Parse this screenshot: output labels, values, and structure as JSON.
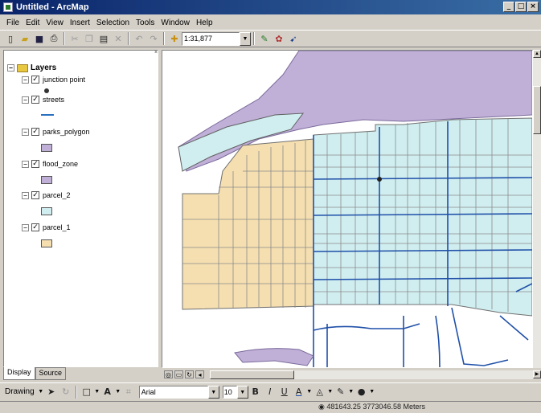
{
  "window": {
    "title": "Untitled - ArcMap",
    "buttons": [
      "_",
      "□",
      "×"
    ]
  },
  "menu": [
    "File",
    "Edit",
    "View",
    "Insert",
    "Selection",
    "Tools",
    "Window",
    "Help"
  ],
  "toolbar": {
    "scale": "1:31,877"
  },
  "toc": {
    "root_label": "Layers",
    "layers": [
      {
        "name": "junction point",
        "symbol": "point",
        "color": "#333333"
      },
      {
        "name": "streets",
        "symbol": "line",
        "color": "#2a6fc0"
      },
      {
        "name": "parks_polygon",
        "symbol": "polygon",
        "color": "#c0b0d8"
      },
      {
        "name": "flood_zone",
        "symbol": "polygon",
        "color": "#c0b0d8"
      },
      {
        "name": "parcel_2",
        "symbol": "polygon",
        "color": "#d0eef0"
      },
      {
        "name": "parcel_1",
        "symbol": "polygon",
        "color": "#f5dfb0"
      }
    ],
    "tabs": [
      "Display",
      "Source"
    ]
  },
  "drawing": {
    "label": "Drawing",
    "font": "Arial",
    "size": "10"
  },
  "status": {
    "coordinates": "481643.25  3773046.58 Meters"
  },
  "colors": {
    "flood": "#c0b0d8",
    "parcel1": "#f5dfb0",
    "parcel2": "#d0eef0",
    "street": "#1f4fa8",
    "parcel_line": "#707070"
  }
}
